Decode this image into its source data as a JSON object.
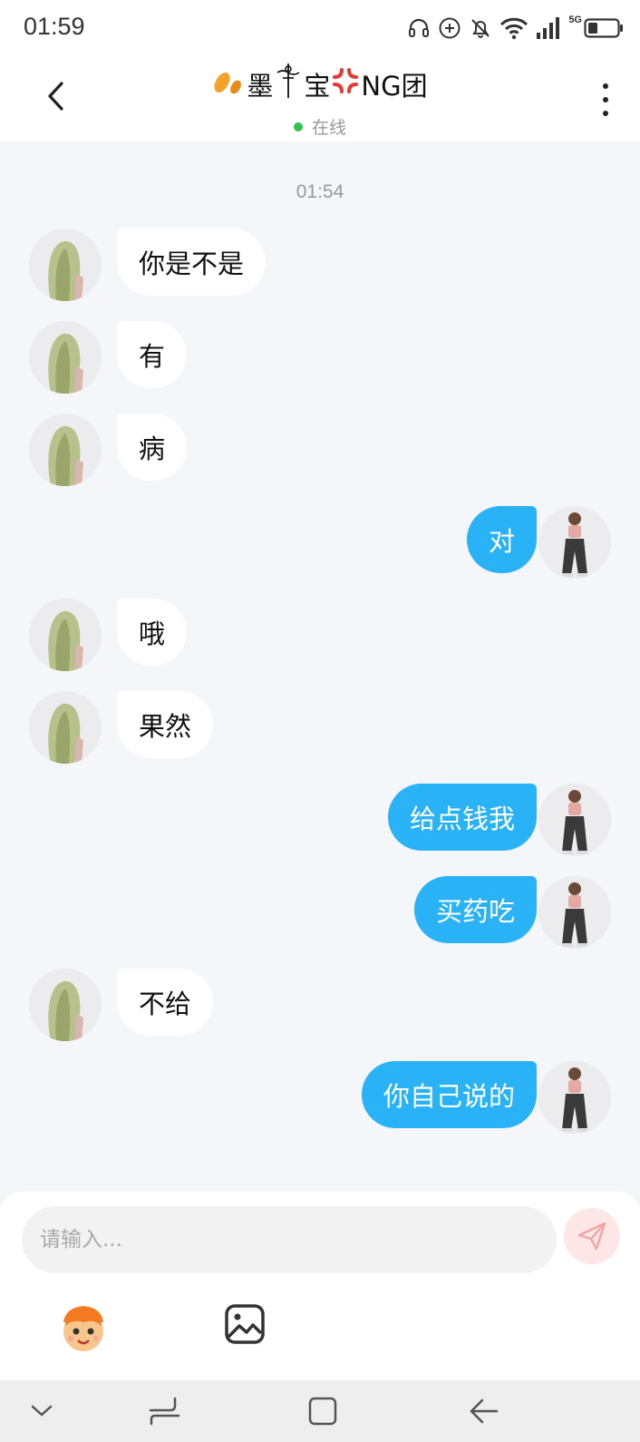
{
  "status_bar": {
    "time": "01:59",
    "network": "5G",
    "icons": [
      "headset-icon",
      "plus-circle-icon",
      "mute-bell-icon",
      "wifi-icon",
      "signal-icon",
      "battery-icon"
    ]
  },
  "header": {
    "title": "墨",
    "title_part2": "宝",
    "title_part3": "NG团",
    "status": "在线",
    "icons": [
      "back-arrow-icon",
      "leaf-emoji-icon",
      "staff-symbol-icon",
      "anger-emoji-icon",
      "more-vertical-icon"
    ]
  },
  "conversation": {
    "timestamp": "01:54",
    "messages": [
      {
        "side": "left",
        "text": "你是不是"
      },
      {
        "side": "left",
        "text": "有"
      },
      {
        "side": "left",
        "text": "病"
      },
      {
        "side": "right",
        "text": "对"
      },
      {
        "side": "left",
        "text": "哦"
      },
      {
        "side": "left",
        "text": "果然"
      },
      {
        "side": "right",
        "text": "给点钱我"
      },
      {
        "side": "right",
        "text": "买药吃"
      },
      {
        "side": "left",
        "text": "不给"
      },
      {
        "side": "right",
        "text": "你自己说的"
      }
    ]
  },
  "composer": {
    "placeholder": "请输入...",
    "value": "",
    "icons": [
      "send-icon",
      "emoji-face-icon",
      "image-icon"
    ]
  },
  "colors": {
    "background": "#f4f6f9",
    "sent_bubble": "#29b3f6",
    "received_bubble": "#ffffff",
    "online_dot": "#2fc24c",
    "send_button": "#fde6e6"
  },
  "nav_bar": {
    "icons": [
      "chevron-down-icon",
      "recents-icon",
      "home-square-icon",
      "back-icon"
    ]
  }
}
